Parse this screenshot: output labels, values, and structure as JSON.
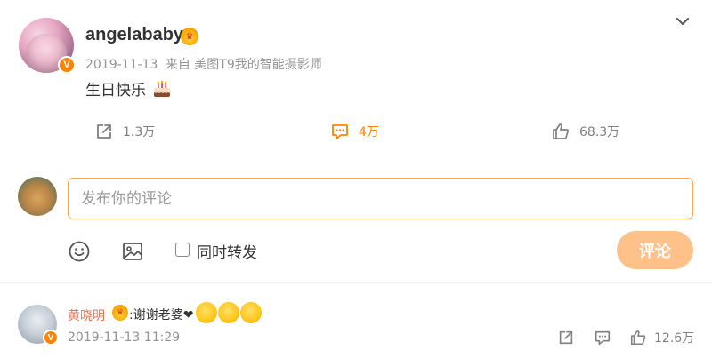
{
  "post": {
    "username": "angelababy",
    "date": "2019-11-13",
    "source": "来自 美图T9我的智能摄影师",
    "text": "生日快乐",
    "verified_badge": "V",
    "badge_icon": "crown-icon",
    "text_emoji": "cake-icon"
  },
  "actions": {
    "repost": {
      "icon": "share-icon",
      "count": "1.3万"
    },
    "comment": {
      "icon": "comment-icon",
      "count": "4万"
    },
    "like": {
      "icon": "thumbs-up-icon",
      "count": "68.3万"
    }
  },
  "composer": {
    "placeholder": "发布你的评论",
    "also_repost_label": "同时转发",
    "submit_label": "评论",
    "tools": [
      "emoji-icon",
      "image-icon"
    ]
  },
  "comment": {
    "author": "黄晓明",
    "text": ":谢谢老婆❤",
    "emojis": [
      "kiss-emoji",
      "kiss-emoji",
      "kiss-emoji"
    ],
    "time": "2019-11-13 11:29",
    "like_count": "12.6万"
  },
  "colors": {
    "accent": "#ff8200",
    "submit_disabled": "#ffc18a",
    "author_name": "#eb7350",
    "input_border": "#ffa34d"
  }
}
